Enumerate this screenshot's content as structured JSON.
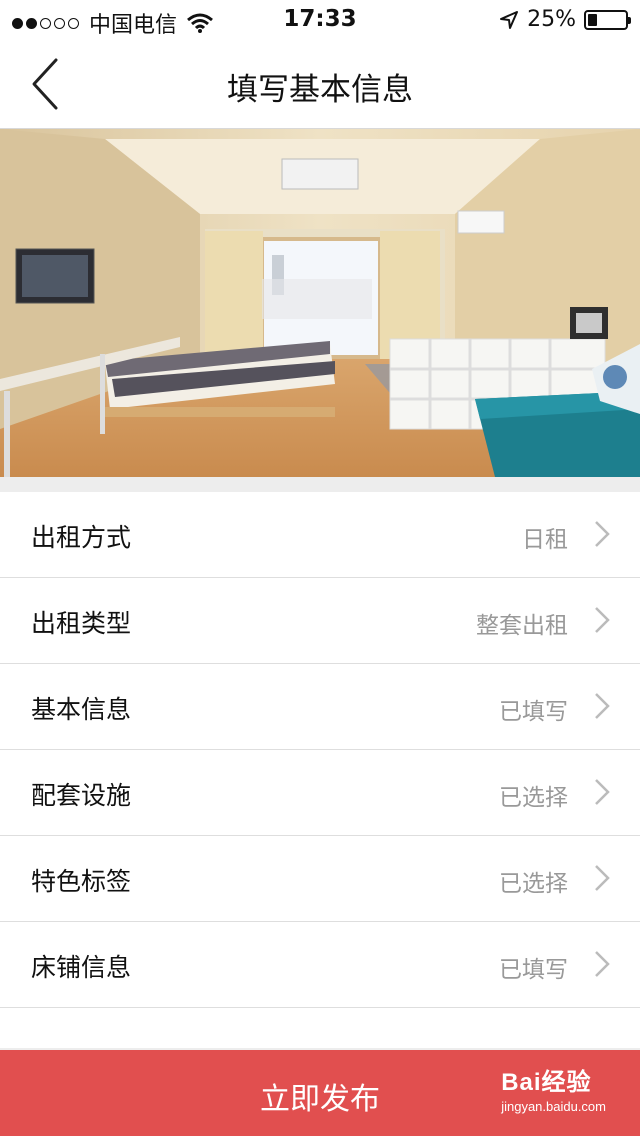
{
  "status_bar": {
    "carrier": "中国电信",
    "time": "17:33",
    "battery": "25%",
    "battery_level": 0.25
  },
  "nav": {
    "title": "填写基本信息",
    "back_icon": "chevron-left-icon"
  },
  "hero": {
    "image": "room-photo"
  },
  "list": {
    "items": [
      {
        "label": "出租方式",
        "value": "日租"
      },
      {
        "label": "出租类型",
        "value": "整套出租"
      },
      {
        "label": "基本信息",
        "value": "已填写"
      },
      {
        "label": "配套设施",
        "value": "已选择"
      },
      {
        "label": "特色标签",
        "value": "已选择"
      },
      {
        "label": "床铺信息",
        "value": "已填写"
      }
    ],
    "chevron_icon": "chevron-right-icon"
  },
  "footer": {
    "publish_label": "立即发布",
    "watermark_brand": "Bai经验",
    "watermark_url": "jingyan.baidu.com"
  },
  "colors": {
    "accent": "#e14f4f",
    "value_text": "#999999"
  }
}
